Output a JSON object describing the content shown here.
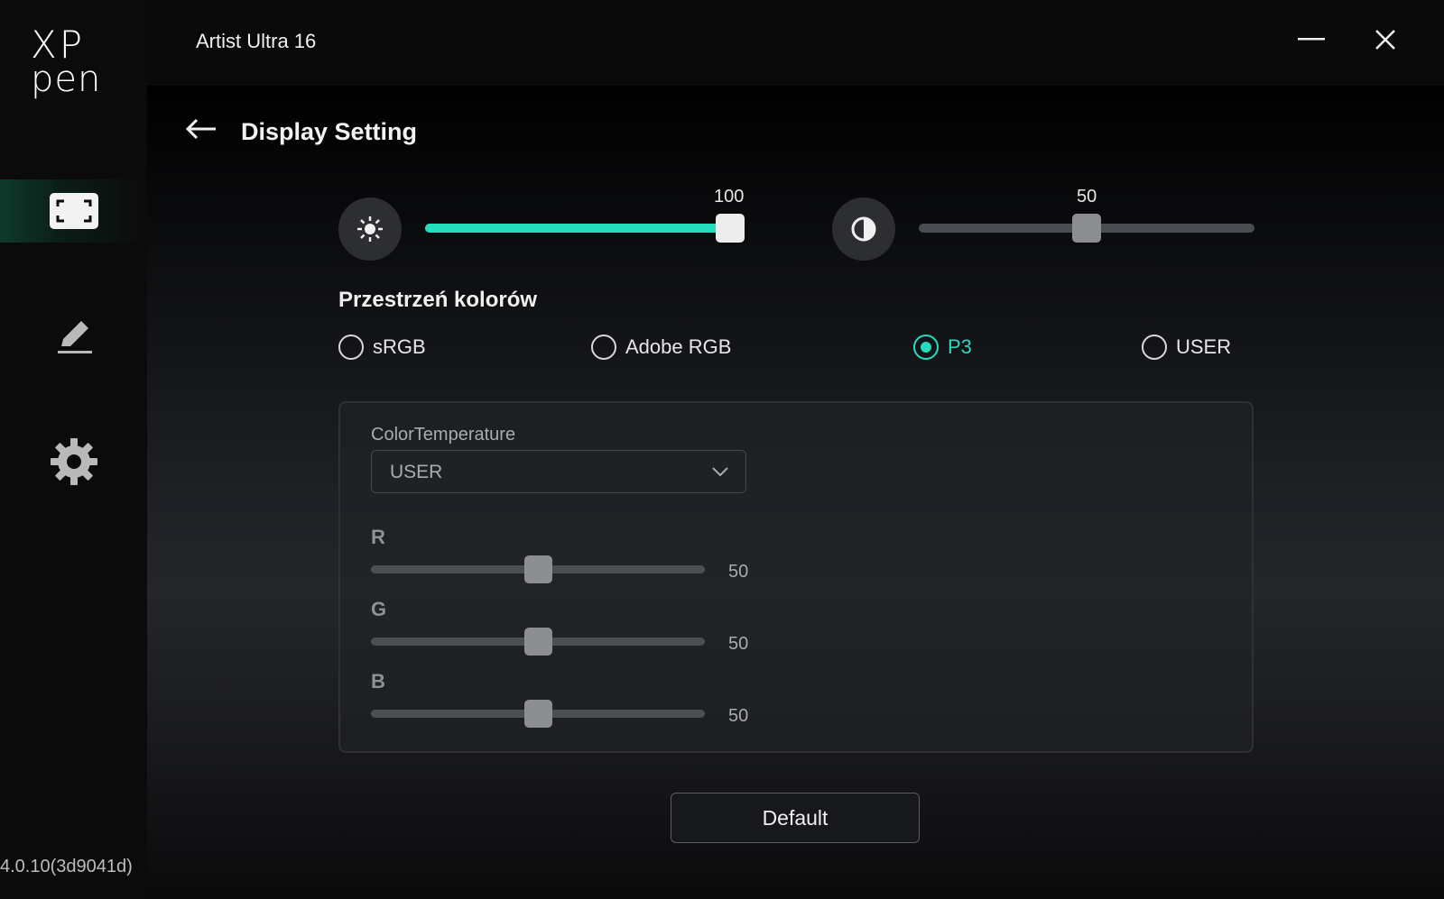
{
  "logo": {
    "line1": "XP",
    "line2": "pen"
  },
  "sidebar": {
    "items": [
      {
        "name": "display",
        "icon": "display-fullscreen-icon",
        "active": true
      },
      {
        "name": "pen",
        "icon": "pen-icon",
        "active": false
      },
      {
        "name": "settings",
        "icon": "gear-icon",
        "active": false
      }
    ],
    "version": "4.0.10(3d9041d)"
  },
  "titlebar": {
    "title": "Artist Ultra 16",
    "minimize_icon": "minimize-icon",
    "close_icon": "close-icon"
  },
  "page": {
    "title": "Display Setting",
    "back_icon": "back-arrow-icon"
  },
  "brightness": {
    "value": 100,
    "min": 0,
    "max": 100,
    "label": "100",
    "icon": "sun-icon"
  },
  "contrast": {
    "value": 50,
    "min": 0,
    "max": 100,
    "label": "50",
    "icon": "contrast-icon"
  },
  "color_space": {
    "title": "Przestrzeń kolorów",
    "options": [
      "sRGB",
      "Adobe RGB",
      "P3",
      "USER"
    ],
    "selected": "P3"
  },
  "color_temperature": {
    "label": "ColorTemperature",
    "value": "USER",
    "chevron_icon": "chevron-down-icon"
  },
  "rgb": [
    {
      "channel": "R",
      "value": 50,
      "min": 0,
      "max": 100,
      "label": "50"
    },
    {
      "channel": "G",
      "value": 50,
      "min": 0,
      "max": 100,
      "label": "50"
    },
    {
      "channel": "B",
      "value": 50,
      "min": 0,
      "max": 100,
      "label": "50"
    }
  ],
  "default_button": "Default",
  "colors": {
    "accent": "#25dcbd",
    "sidebar_active": "#0e3b2c",
    "background": "#000000"
  }
}
